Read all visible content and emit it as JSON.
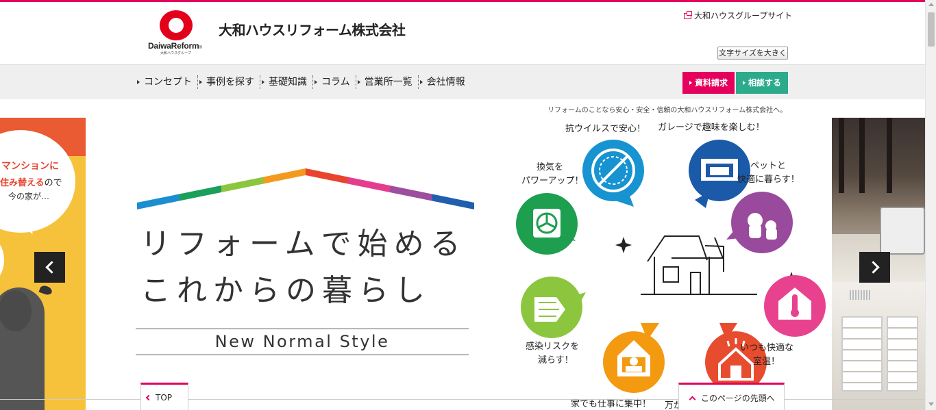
{
  "header": {
    "logo_word": "DaiwaReform",
    "logo_registered": "®",
    "logo_sub": "大和ハウスグループ",
    "company_name": "大和ハウスリフォーム株式会社",
    "group_site_link": "大和ハウスグループサイト",
    "font_size_button": "文字サイズを大きく"
  },
  "nav": {
    "items": [
      {
        "label": "コンセプト"
      },
      {
        "label": "事例を探す"
      },
      {
        "label": "基礎知識"
      },
      {
        "label": "コラム"
      },
      {
        "label": "営業所一覧"
      },
      {
        "label": "会社情報"
      }
    ],
    "cta_request": "資料請求",
    "cta_consult": "相談する"
  },
  "tagline": "リフォームのことなら安心・安全・信頼の大和ハウスリフォーム株式会社へ。",
  "slider": {
    "left_slide": {
      "line1": "マンションに",
      "line2_highlight": "住み替える",
      "line2_rest": "ので",
      "line3": "今の家が…"
    },
    "main_slide": {
      "headline_line1": "リフォームで始める",
      "headline_line2": "これからの暮らし",
      "subtitle": "New Normal Style",
      "labels": {
        "antivirus": "抗ウイルスで安心！",
        "garage": "ガレージで趣味を楽しむ！",
        "ventilation_1": "換気を",
        "ventilation_2": "パワーアップ！",
        "pet_1": "ペットと",
        "pet_2": "快適に暮らす！",
        "infection_1": "感染リスクを",
        "infection_2": "減らす！",
        "temp_1": "いつも快適な",
        "temp_2": "室温！",
        "work": "家でも仕事に集中！",
        "partial": "万が"
      },
      "roof_colors": [
        "#1b8ed0",
        "#1aa05a",
        "#8cc63f",
        "#f39a1e",
        "#e8442e",
        "#e53d8e",
        "#9c4f9e",
        "#1f5fae"
      ],
      "icon_colors": {
        "blue": "#1793d1",
        "navy": "#1a5aa8",
        "green": "#1d9f4f",
        "purple": "#9a4a9c",
        "lime": "#8cc63f",
        "pink": "#e8428f",
        "orange": "#f39a10",
        "red": "#e74c2e"
      }
    },
    "prev_label": "prev",
    "next_label": "next"
  },
  "footer_tabs": {
    "top": "TOP",
    "page_top": "このページの先頭へ"
  }
}
